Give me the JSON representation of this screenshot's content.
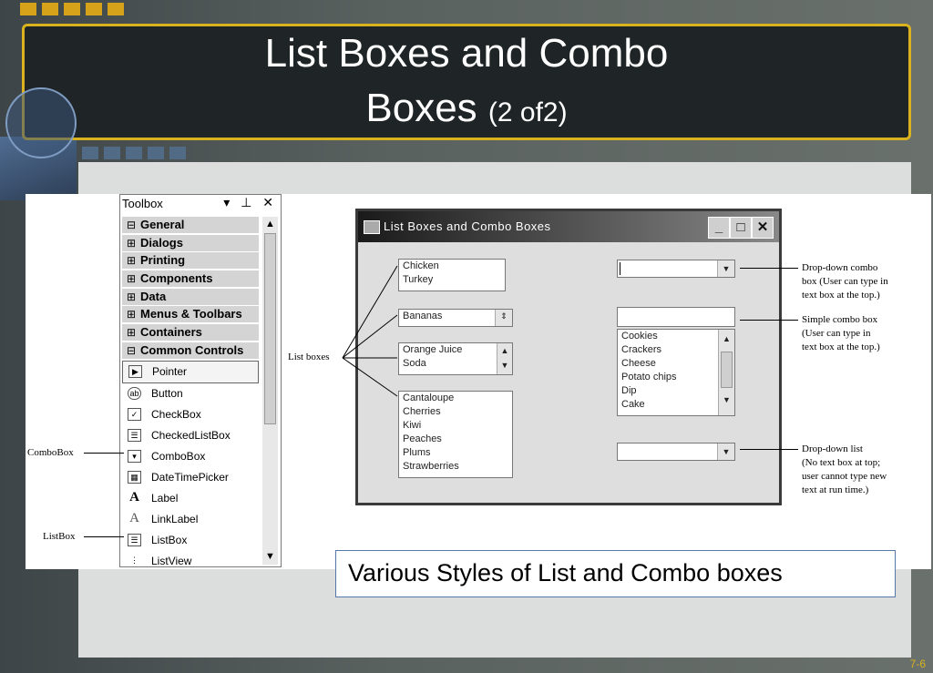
{
  "slide": {
    "title_line1": "List Boxes and Combo",
    "title_line2": "Boxes",
    "title_suffix": "(2 of2)",
    "caption": "Various Styles of List and Combo boxes",
    "slide_number": "7-6",
    "accent_color": "#d9b21d"
  },
  "toolbox": {
    "title": "Toolbox",
    "controls": "▾ ⊥ ✕",
    "categories": [
      {
        "sign": "⊟",
        "label": "General"
      },
      {
        "sign": "⊞",
        "label": "Dialogs"
      },
      {
        "sign": "⊞",
        "label": "Printing"
      },
      {
        "sign": "⊞",
        "label": "Components"
      },
      {
        "sign": "⊞",
        "label": "Data"
      },
      {
        "sign": "⊞",
        "label": "Menus & Toolbars"
      },
      {
        "sign": "⊞",
        "label": "Containers"
      },
      {
        "sign": "⊟",
        "label": "Common Controls"
      }
    ],
    "items": [
      {
        "icon": "pointer-icon",
        "glyph": "▶",
        "label": "Pointer"
      },
      {
        "icon": "button-icon",
        "glyph": "ab",
        "label": "Button"
      },
      {
        "icon": "checkbox-icon",
        "glyph": "✓",
        "label": "CheckBox"
      },
      {
        "icon": "checkedlistbox-icon",
        "glyph": "☰",
        "label": "CheckedListBox"
      },
      {
        "icon": "combobox-icon",
        "glyph": "▾",
        "label": "ComboBox"
      },
      {
        "icon": "datetimepicker-icon",
        "glyph": "▦",
        "label": "DateTimePicker"
      },
      {
        "icon": "label-icon",
        "glyph": "A",
        "label": "Label"
      },
      {
        "icon": "linklabel-icon",
        "glyph": "A",
        "label": "LinkLabel"
      },
      {
        "icon": "listbox-icon",
        "glyph": "☰",
        "label": "ListBox"
      },
      {
        "icon": "listview-icon",
        "glyph": "⋮",
        "label": "ListView"
      }
    ]
  },
  "figure_labels": {
    "combobox": "ComboBox",
    "listbox": "ListBox",
    "list_boxes": "List boxes"
  },
  "form": {
    "title": "List Boxes and Combo Boxes",
    "listbox1": [
      "Chicken",
      "Turkey"
    ],
    "listbox2": [
      "Bananas"
    ],
    "listbox3": [
      "Orange Juice",
      "Soda"
    ],
    "listbox4": [
      "Cantaloupe",
      "Cherries",
      "Kiwi",
      "Peaches",
      "Plums",
      "Strawberries"
    ],
    "simple_combo_items": [
      "Cookies",
      "Crackers",
      "Cheese",
      "Potato chips",
      "Dip",
      "Cake"
    ]
  },
  "annotations": {
    "dropdown_combo": [
      "Drop-down combo",
      "box (User can type in",
      "text box at the top.)"
    ],
    "simple_combo": [
      "Simple combo box",
      "(User can type in",
      "text box at the top.)"
    ],
    "dropdown_list": [
      "Drop-down list",
      "(No text box at top;",
      "user cannot type new",
      "text at run time.)"
    ]
  }
}
